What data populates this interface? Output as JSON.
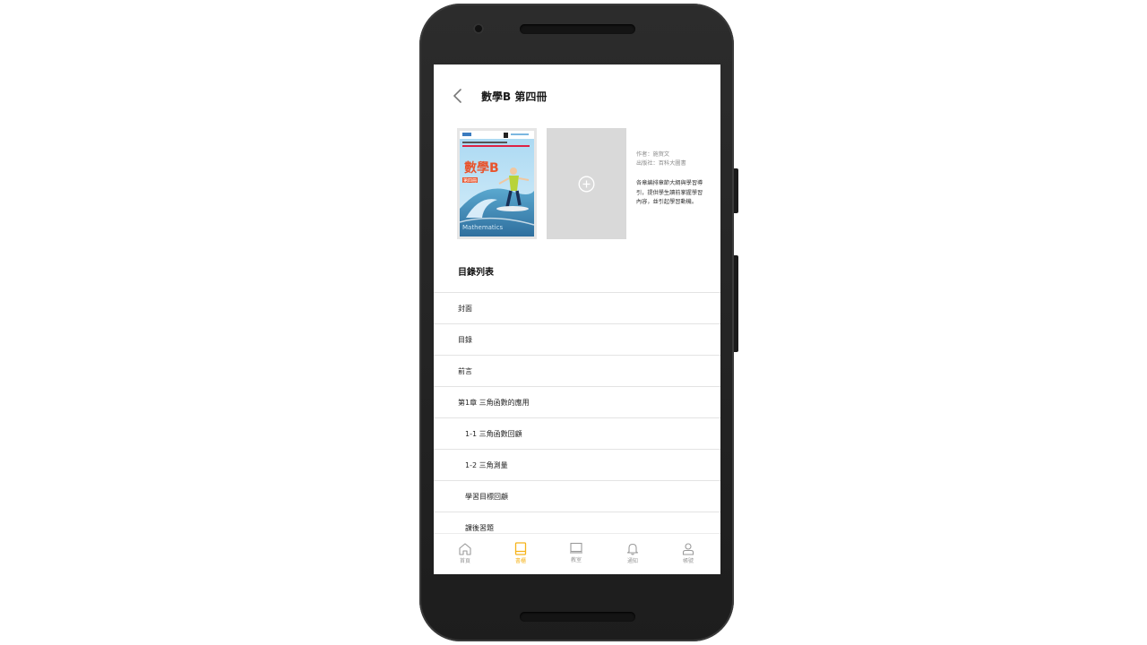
{
  "header": {
    "title": "數學B 第四冊"
  },
  "book": {
    "cover": {
      "title": "數學B",
      "volume": "第四冊",
      "subtitle": "Mathematics"
    },
    "meta": {
      "author": "作者：施賀文",
      "publisher": "出版社：百科大圖書"
    },
    "description": "各章編排章節大綱與學習導引，提供學生讀前掌握學習內容，並引起學習動機。"
  },
  "toc": {
    "title": "目錄列表",
    "items": [
      {
        "label": "封面",
        "sub": false
      },
      {
        "label": "目錄",
        "sub": false
      },
      {
        "label": "前言",
        "sub": false
      },
      {
        "label": "第1章 三角函數的應用",
        "sub": false
      },
      {
        "label": "1-1 三角函數回顧",
        "sub": true
      },
      {
        "label": "1-2 三角測量",
        "sub": true
      },
      {
        "label": "學習目標回顧",
        "sub": true
      },
      {
        "label": "課後習題",
        "sub": true
      }
    ]
  },
  "bottom_nav": {
    "items": [
      {
        "label": "首頁",
        "icon": "home-icon"
      },
      {
        "label": "書櫃",
        "icon": "book-icon",
        "active": true
      },
      {
        "label": "教室",
        "icon": "classroom-icon"
      },
      {
        "label": "通知",
        "icon": "bell-icon"
      },
      {
        "label": "帳號",
        "icon": "user-icon"
      }
    ]
  },
  "colors": {
    "accent": "#f5b31b",
    "inactive": "#9a9a9a",
    "divider": "#e3e3e3"
  }
}
